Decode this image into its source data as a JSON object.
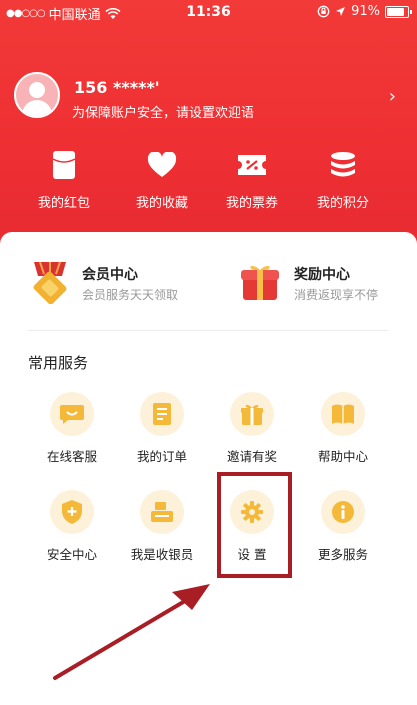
{
  "status_bar": {
    "carrier": "中国联通",
    "time": "11:36",
    "battery_percent": "91%",
    "battery_level": 0.91
  },
  "profile": {
    "phone": "156 *****'",
    "greeting": "为保障账户安全，请设置欢迎语"
  },
  "quick_actions": [
    {
      "label": "我的红包",
      "icon": "red-packet-icon"
    },
    {
      "label": "我的收藏",
      "icon": "heart-icon"
    },
    {
      "label": "我的票券",
      "icon": "ticket-icon"
    },
    {
      "label": "我的积分",
      "icon": "coins-icon"
    }
  ],
  "promos": [
    {
      "title": "会员中心",
      "subtitle": "会员服务天天领取",
      "icon": "medal-icon"
    },
    {
      "title": "奖励中心",
      "subtitle": "消费返现享不停",
      "icon": "gift-box-icon"
    }
  ],
  "services_title": "常用服务",
  "services": [
    {
      "label": "在线客服",
      "icon": "chat-icon"
    },
    {
      "label": "我的订单",
      "icon": "order-icon"
    },
    {
      "label": "邀请有奖",
      "icon": "gift-icon"
    },
    {
      "label": "帮助中心",
      "icon": "book-icon"
    },
    {
      "label": "安全中心",
      "icon": "shield-icon"
    },
    {
      "label": "我是收银员",
      "icon": "cashier-icon"
    },
    {
      "label": "设 置",
      "icon": "gear-icon"
    },
    {
      "label": "更多服务",
      "icon": "info-icon"
    }
  ],
  "colors": {
    "header_red": "#ee2f33",
    "icon_gold": "#f5b93a",
    "icon_bg": "#fdf1d9",
    "annotation_red": "#a81e24"
  }
}
